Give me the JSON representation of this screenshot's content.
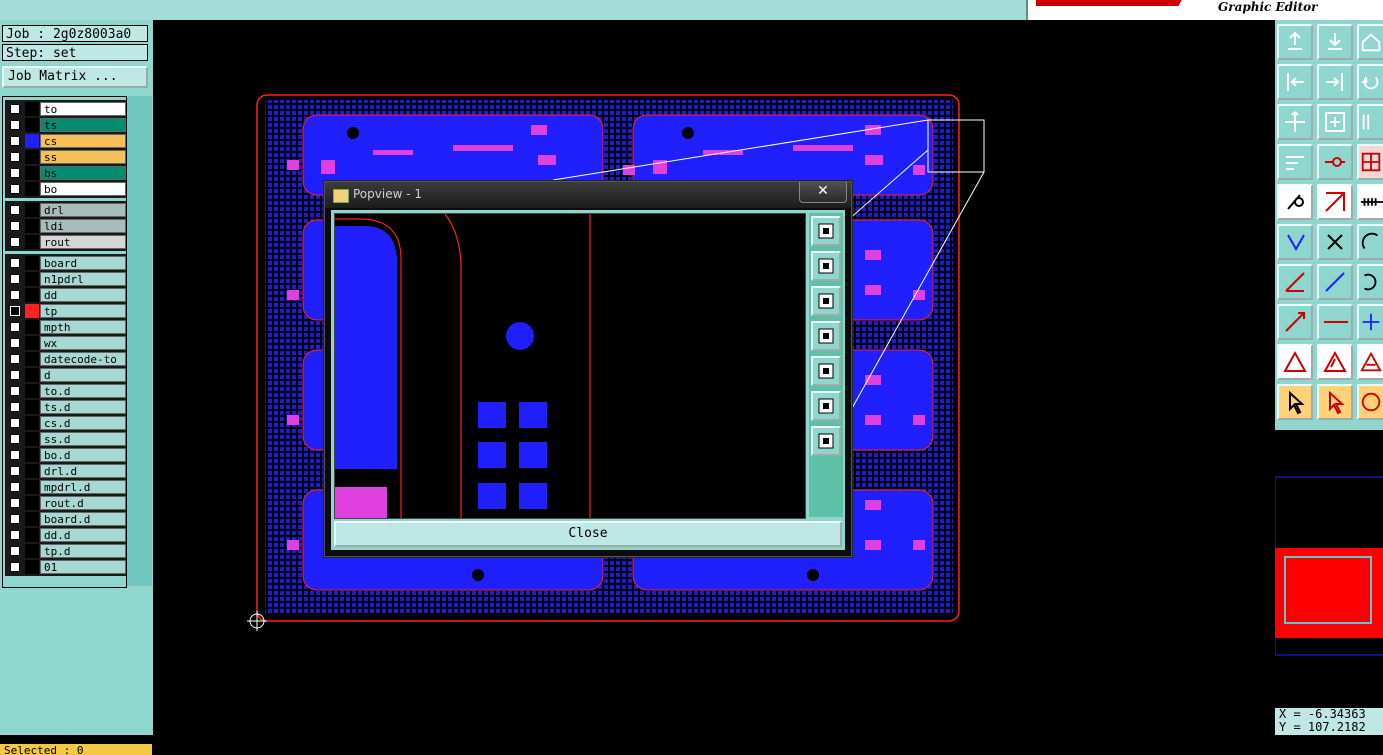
{
  "header": {
    "brand_subtitle": "Graphic Editor"
  },
  "job": {
    "job_label": "Job : 2g0z8003a0",
    "step_label": "Step: set",
    "job_matrix_button": "Job Matrix ..."
  },
  "layers": {
    "group1": [
      {
        "name": "to",
        "color": "#ffffff"
      },
      {
        "name": "ts",
        "color": "#008c6e"
      },
      {
        "name": "cs",
        "color": "#f5c25a",
        "swatch": "#2020ff"
      },
      {
        "name": "ss",
        "color": "#f5c25a"
      },
      {
        "name": "bs",
        "color": "#008c6e"
      },
      {
        "name": "bo",
        "color": "#ffffff"
      }
    ],
    "group2": [
      {
        "name": "drl",
        "color": "#a9bcbc"
      },
      {
        "name": "ldi",
        "color": "#a9bcbc"
      },
      {
        "name": "rout",
        "color": "#d6d6d6"
      }
    ],
    "group3": [
      {
        "name": "board",
        "color": "#a7d8d4"
      },
      {
        "name": "n1pdrl",
        "color": "#a7d8d4"
      },
      {
        "name": "dd",
        "color": "#a7d8d4"
      },
      {
        "name": "tp",
        "color": "#a7d8d4",
        "swatch": "#ff2020",
        "checked": true
      },
      {
        "name": "mpth",
        "color": "#a7d8d4"
      },
      {
        "name": "wx",
        "color": "#a7d8d4"
      },
      {
        "name": "datecode-to",
        "color": "#a7d8d4"
      },
      {
        "name": "d",
        "color": "#a7d8d4"
      },
      {
        "name": "to.d",
        "color": "#a7d8d4"
      },
      {
        "name": "ts.d",
        "color": "#a7d8d4"
      },
      {
        "name": "cs.d",
        "color": "#a7d8d4"
      },
      {
        "name": "ss.d",
        "color": "#a7d8d4"
      },
      {
        "name": "bo.d",
        "color": "#a7d8d4"
      },
      {
        "name": "drl.d",
        "color": "#a7d8d4"
      },
      {
        "name": "mpdrl.d",
        "color": "#a7d8d4"
      },
      {
        "name": "rout.d",
        "color": "#a7d8d4"
      },
      {
        "name": "board.d",
        "color": "#a7d8d4"
      },
      {
        "name": "dd.d",
        "color": "#a7d8d4"
      },
      {
        "name": "tp.d",
        "color": "#a7d8d4"
      },
      {
        "name": "01",
        "color": "#a7d8d4"
      }
    ]
  },
  "status": {
    "selected": "Selected : 0",
    "x_coord": "X = -6.34363",
    "y_coord": "Y = 107.2182"
  },
  "popview": {
    "title": "Popview - 1",
    "close_x": "✕",
    "close_button": "Close"
  },
  "colors": {
    "panel": "#8fd6cf",
    "copper": "#2020ff",
    "pad": "#e040e0",
    "outline": "#ff2020"
  }
}
